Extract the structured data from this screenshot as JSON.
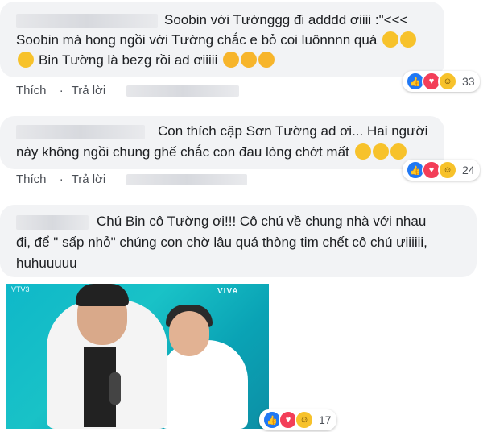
{
  "comments": [
    {
      "lines": [
        "Soobin với Tườnggg đi adddd ơiiii :\"<<<",
        "Soobin mà hong ngồi với Tường chắc e bỏ coi luônnnn quá",
        "Bin Tường là bezg rồi ad ơiiiii"
      ],
      "actions": {
        "like": "Thích",
        "reply": "Trả lời"
      },
      "reactions": {
        "count": "33",
        "icons": [
          "like-icon",
          "love-icon",
          "haha-icon"
        ]
      }
    },
    {
      "lines": [
        "Con thích cặp Sơn Tường ad ơi... Hai người",
        "này không ngồi chung ghế chắc con đau lòng chớt mất"
      ],
      "actions": {
        "like": "Thích",
        "reply": "Trả lời"
      },
      "reactions": {
        "count": "24",
        "icons": [
          "like-icon",
          "love-icon",
          "haha-icon"
        ]
      }
    },
    {
      "lines": [
        "Chú Bin cô Tường ơi!!! Cô chú về chung nhà với nhau",
        "đi, để \" sấp nhỏ\" chúng con chờ lâu quá thòng tim chết cô chú ưiiiiii,",
        "huhuuuuu"
      ],
      "reactions": {
        "count": "17",
        "icons": [
          "like-icon",
          "love-icon",
          "haha-icon"
        ]
      },
      "photo": {
        "logo_text": "VIVA",
        "corner_text": "VTV3"
      }
    }
  ],
  "colors": {
    "like": "#2078f4",
    "love": "#f33e58",
    "haha": "#f7c22b",
    "bubble": "#f2f3f5"
  }
}
